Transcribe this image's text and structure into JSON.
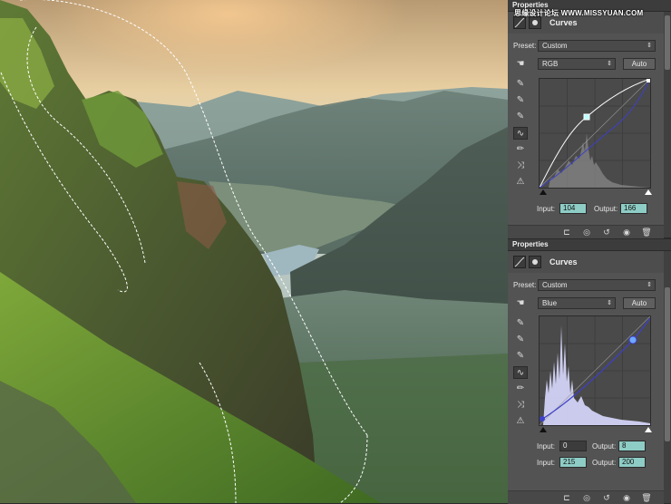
{
  "watermark": "思缘设计论坛  WWW.MISSYUAN.COM",
  "panel1": {
    "title": "Properties",
    "header_title": "Curves",
    "preset_label": "Preset:",
    "preset_value": "Custom",
    "channel_value": "RGB",
    "auto_label": "Auto",
    "input_label": "Input:",
    "input_value": "104",
    "output_label": "Output:",
    "output_value": "166"
  },
  "panel2": {
    "title": "Properties",
    "header_title": "Curves",
    "preset_label": "Preset:",
    "preset_value": "Custom",
    "channel_value": "Blue",
    "auto_label": "Auto",
    "row1": {
      "input_label": "Input:",
      "input_value": "0",
      "output_label": "Output:",
      "output_value": "8"
    },
    "row2": {
      "input_label": "Input:",
      "input_value": "215",
      "output_label": "Output:",
      "output_value": "200"
    }
  },
  "icons": {
    "tools": [
      "on-image-adjust-icon",
      "eyedropper-black-icon",
      "eyedropper-gray-icon",
      "eyedropper-white-icon",
      "curve-edit-icon",
      "pencil-icon",
      "smooth-icon",
      "clipping-warning-icon"
    ],
    "footer": [
      "clip-to-layer-icon",
      "view-previous-icon",
      "reset-icon",
      "visibility-icon",
      "trash-icon"
    ]
  },
  "colors": {
    "panel_bg": "#535353",
    "field_teal": "#8ecdc6",
    "curve_white": "#ffffff",
    "curve_blue": "#3d40c8"
  }
}
